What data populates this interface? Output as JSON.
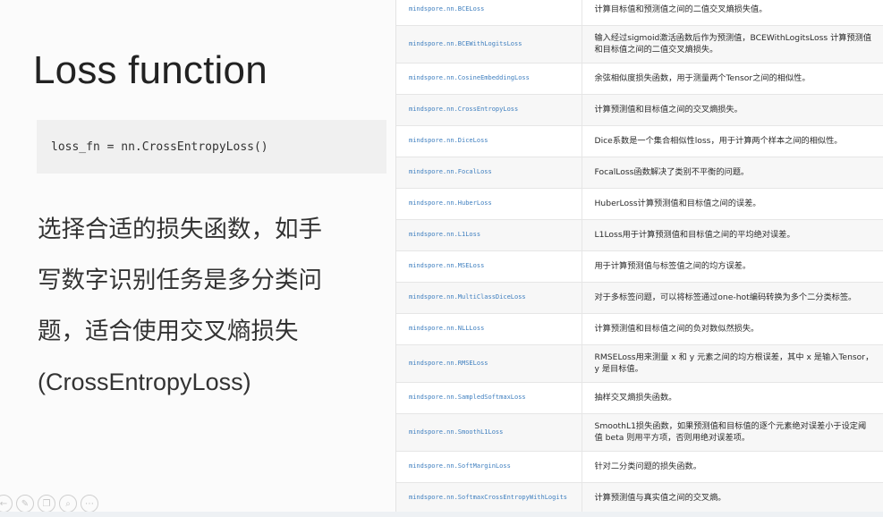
{
  "slide": {
    "title": "Loss function",
    "code": "loss_fn = nn.CrossEntropyLoss()",
    "paragraph_lines": [
      "选择合适的损失函数，如手",
      "写数字识别任务是多分类问",
      "题，适合使用交叉熵损失",
      "(CrossEntropyLoss)"
    ]
  },
  "table": {
    "rows": [
      {
        "name": "mindspore.nn.BCELoss",
        "desc": "计算目标值和预测值之间的二值交叉熵损失值。"
      },
      {
        "name": "mindspore.nn.BCEWithLogitsLoss",
        "desc": "输入经过sigmoid激活函数后作为预测值，BCEWithLogitsLoss 计算预测值和目标值之间的二值交叉熵损失。"
      },
      {
        "name": "mindspore.nn.CosineEmbeddingLoss",
        "desc": "余弦相似度损失函数，用于测量两个Tensor之间的相似性。"
      },
      {
        "name": "mindspore.nn.CrossEntropyLoss",
        "desc": "计算预测值和目标值之间的交叉熵损失。"
      },
      {
        "name": "mindspore.nn.DiceLoss",
        "desc": "Dice系数是一个集合相似性loss，用于计算两个样本之间的相似性。"
      },
      {
        "name": "mindspore.nn.FocalLoss",
        "desc": "FocalLoss函数解决了类别不平衡的问题。"
      },
      {
        "name": "mindspore.nn.HuberLoss",
        "desc": "HuberLoss计算预测值和目标值之间的误差。"
      },
      {
        "name": "mindspore.nn.L1Loss",
        "desc": "L1Loss用于计算预测值和目标值之间的平均绝对误差。"
      },
      {
        "name": "mindspore.nn.MSELoss",
        "desc": "用于计算预测值与标签值之间的均方误差。"
      },
      {
        "name": "mindspore.nn.MultiClassDiceLoss",
        "desc": "对于多标签问题，可以将标签通过one-hot编码转换为多个二分类标签。"
      },
      {
        "name": "mindspore.nn.NLLLoss",
        "desc": "计算预测值和目标值之间的负对数似然损失。"
      },
      {
        "name": "mindspore.nn.RMSELoss",
        "desc": "RMSELoss用来测量 x 和 y 元素之间的均方根误差，其中 x 是输入Tensor， y 是目标值。"
      },
      {
        "name": "mindspore.nn.SampledSoftmaxLoss",
        "desc": "抽样交叉熵损失函数。"
      },
      {
        "name": "mindspore.nn.SmoothL1Loss",
        "desc": "SmoothL1损失函数，如果预测值和目标值的逐个元素绝对误差小于设定阈值 beta 则用平方项，否则用绝对误差项。"
      },
      {
        "name": "mindspore.nn.SoftMarginLoss",
        "desc": "针对二分类问题的损失函数。"
      },
      {
        "name": "mindspore.nn.SoftmaxCrossEntropyWithLogits",
        "desc": "计算预测值与真实值之间的交叉熵。"
      }
    ]
  },
  "toolbar": {
    "icons": [
      "arrow-icon",
      "pen-icon",
      "copy-icon",
      "zoom-icon",
      "more-icon"
    ]
  }
}
